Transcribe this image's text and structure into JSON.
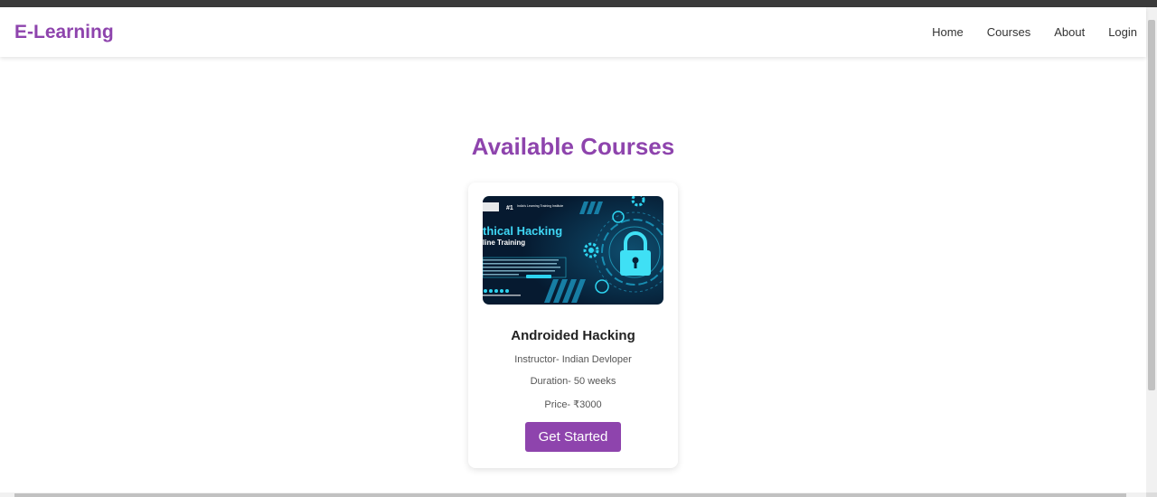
{
  "nav": {
    "brand": "E-Learning",
    "links": [
      {
        "label": "Home"
      },
      {
        "label": "Courses"
      },
      {
        "label": "About"
      },
      {
        "label": "Login"
      }
    ]
  },
  "main": {
    "title": "Available Courses",
    "courses": [
      {
        "title": "Androided Hacking",
        "instructor": "Instructor- Indian Devloper",
        "duration": "Duration- 50 weeks",
        "price": "Price- ₹3000",
        "cta": "Get Started",
        "image": {
          "badge_rank": "#1",
          "badge_text": "India's Learning Training Institute",
          "headline": "thical Hacking",
          "subheadline": "line Training"
        }
      }
    ]
  },
  "colors": {
    "accent": "#8e44ad",
    "image_bg": "#06223a",
    "image_glow": "#22d3ee"
  }
}
